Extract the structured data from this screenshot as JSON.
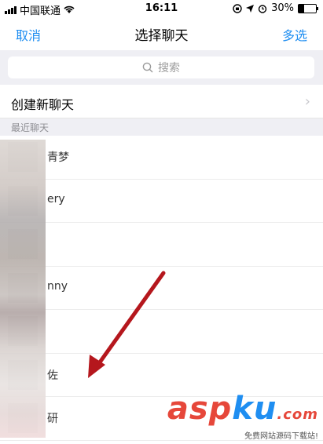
{
  "status_bar": {
    "carrier": "中国联通",
    "time": "16:11",
    "battery_percent": "30%",
    "battery_level": 0.3
  },
  "nav": {
    "cancel": "取消",
    "title": "选择聊天",
    "multi_select": "多选"
  },
  "search": {
    "placeholder": "搜索"
  },
  "create_new_chat": "创建新聊天",
  "recent_section": "最近聊天",
  "chats": [
    {
      "name": "青梦"
    },
    {
      "name": "ery"
    },
    {
      "name": ""
    },
    {
      "name": "nny"
    },
    {
      "name": ""
    },
    {
      "name": "佐"
    },
    {
      "name": "研"
    }
  ],
  "watermark": {
    "main_a": "asp",
    "main_b": "ku",
    "main_c": ".com",
    "sub": "免费网站源码下载站!"
  },
  "colors": {
    "accent": "#1f8ef1",
    "arrow": "#b5171d",
    "watermark": "#e6473a"
  }
}
